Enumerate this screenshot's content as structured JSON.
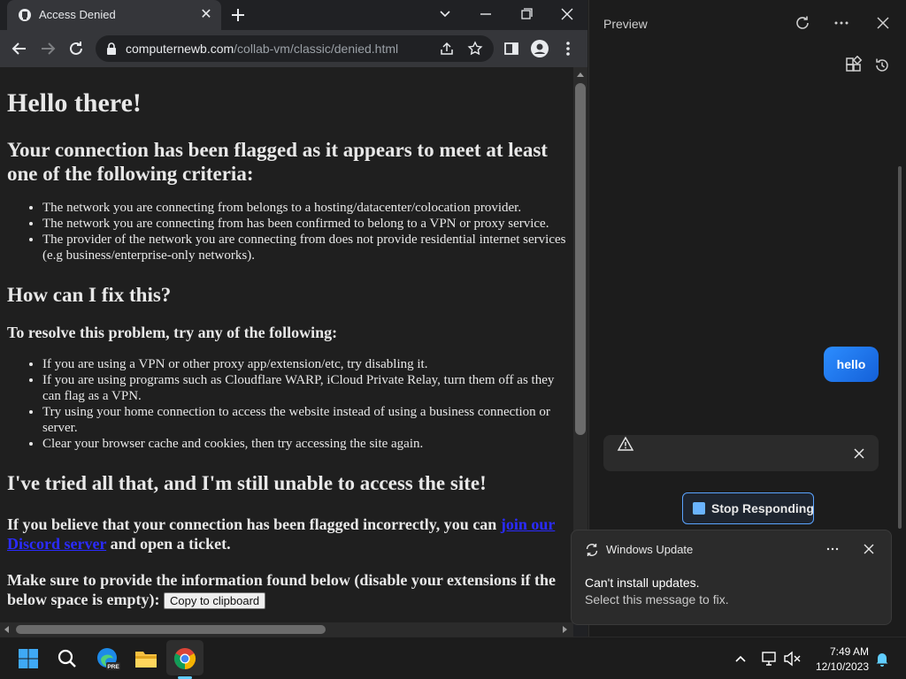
{
  "browser": {
    "tab_title": "Access Denied",
    "url_host": "computernewb.com",
    "url_path": "/collab-vm/classic/denied.html"
  },
  "page": {
    "h1": "Hello there!",
    "criteria_heading": "Your connection has been flagged as it appears to meet at least one of the following criteria:",
    "criteria": [
      "The network you are connecting from belongs to a hosting/datacenter/colocation provider.",
      "The network you are connecting from has been confirmed to belong to a VPN or proxy service.",
      "The provider of the network you are connecting from does not provide residential internet services (e.g business/enterprise-only networks)."
    ],
    "fix_heading": "How can I fix this?",
    "resolve_heading": "To resolve this problem, try any of the following:",
    "fixes": [
      "If you are using a VPN or other proxy app/extension/etc, try disabling it.",
      "If you are using programs such as Cloudflare WARP, iCloud Private Relay, turn them off as they can flag as a VPN.",
      "Try using your home connection to access the website instead of using a business connection or server.",
      "Clear your browser cache and cookies, then try accessing the site again."
    ],
    "tried_heading": "I've tried all that, and I'm still unable to access the site!",
    "incorrect_prefix": "If you believe that your connection has been flagged incorrectly, you can ",
    "incorrect_link": "join our Discord server",
    "incorrect_suffix": " and open a ticket.",
    "info_text": "Make sure to provide the information found below (disable your extensions if the below space is empty): ",
    "copy_button": "Copy to clipboard"
  },
  "preview": {
    "title": "Preview",
    "user_message": "hello",
    "stop_button": "Stop Responding"
  },
  "toast": {
    "app": "Windows Update",
    "title": "Can't install updates.",
    "body": "Select this message to fix."
  },
  "taskbar": {
    "time": "7:49 AM",
    "date": "12/10/2023",
    "apps": [
      "windows-start-icon",
      "search-icon",
      "edge-icon",
      "file-explorer-icon",
      "chrome-icon"
    ]
  },
  "colors": {
    "accent": "#2c8dff",
    "page_bg": "#1f1f1f",
    "link": "#2b2bff"
  }
}
